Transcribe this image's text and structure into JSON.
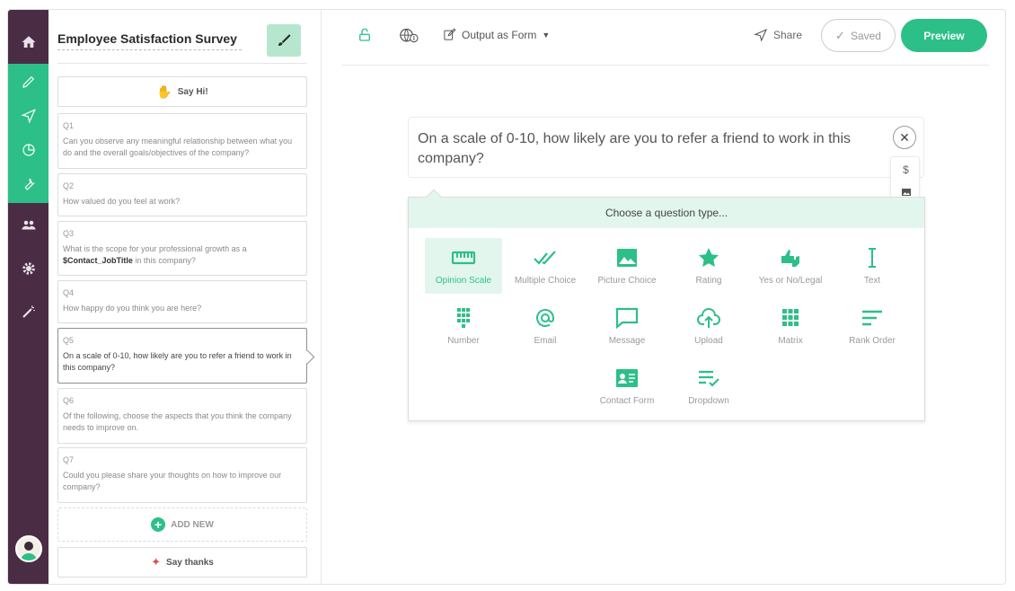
{
  "survey": {
    "title": "Employee Satisfaction Survey"
  },
  "sidebar_cards": {
    "welcome": "Say Hi!",
    "questions": [
      {
        "num": "Q1",
        "text": "Can you observe any meaningful relationship between what you do and the overall goals/objectives of the company?"
      },
      {
        "num": "Q2",
        "text": "How valued do you feel at work?"
      },
      {
        "num": "Q3",
        "text_before": "What is the scope for your professional growth as a ",
        "variable": "$Contact_JobTitle",
        "text_after": " in this company?"
      },
      {
        "num": "Q4",
        "text": "How happy do you think you are here?"
      },
      {
        "num": "Q5",
        "text": "On a scale of 0-10, how likely are you to refer a friend to work in this company?"
      },
      {
        "num": "Q6",
        "text": "Of the following, choose the aspects that you think the company needs to improve on."
      },
      {
        "num": "Q7",
        "text": "Could you please share your thoughts on how to improve our company?"
      }
    ],
    "add_new": "ADD NEW",
    "thanks": "Say thanks"
  },
  "toolbar": {
    "output_label": "Output as Form",
    "share_label": "Share",
    "saved_label": "Saved",
    "preview_label": "Preview"
  },
  "editor": {
    "question_text": "On a scale of 0-10, how likely are you to refer a friend to work in this company?",
    "mini_tools": [
      "$"
    ]
  },
  "type_panel": {
    "header": "Choose a question type...",
    "types": [
      {
        "label": "Opinion Scale",
        "icon": "ruler-icon",
        "selected": true
      },
      {
        "label": "Multiple Choice",
        "icon": "double-check-icon"
      },
      {
        "label": "Picture Choice",
        "icon": "image-icon"
      },
      {
        "label": "Rating",
        "icon": "star-icon"
      },
      {
        "label": "Yes or No/Legal",
        "icon": "thumbs-icon"
      },
      {
        "label": "Text",
        "icon": "text-cursor-icon"
      },
      {
        "label": "Number",
        "icon": "keypad-icon"
      },
      {
        "label": "Email",
        "icon": "at-icon"
      },
      {
        "label": "Message",
        "icon": "message-icon"
      },
      {
        "label": "Upload",
        "icon": "upload-icon"
      },
      {
        "label": "Matrix",
        "icon": "matrix-icon"
      },
      {
        "label": "Rank Order",
        "icon": "rank-icon"
      },
      {
        "label": "Contact Form",
        "icon": "contact-card-icon"
      },
      {
        "label": "Dropdown",
        "icon": "dropdown-list-icon"
      }
    ]
  },
  "colors": {
    "accent": "#2dbf88",
    "nav_bg": "#4a2d44",
    "accent_light": "#e3f6ee"
  }
}
